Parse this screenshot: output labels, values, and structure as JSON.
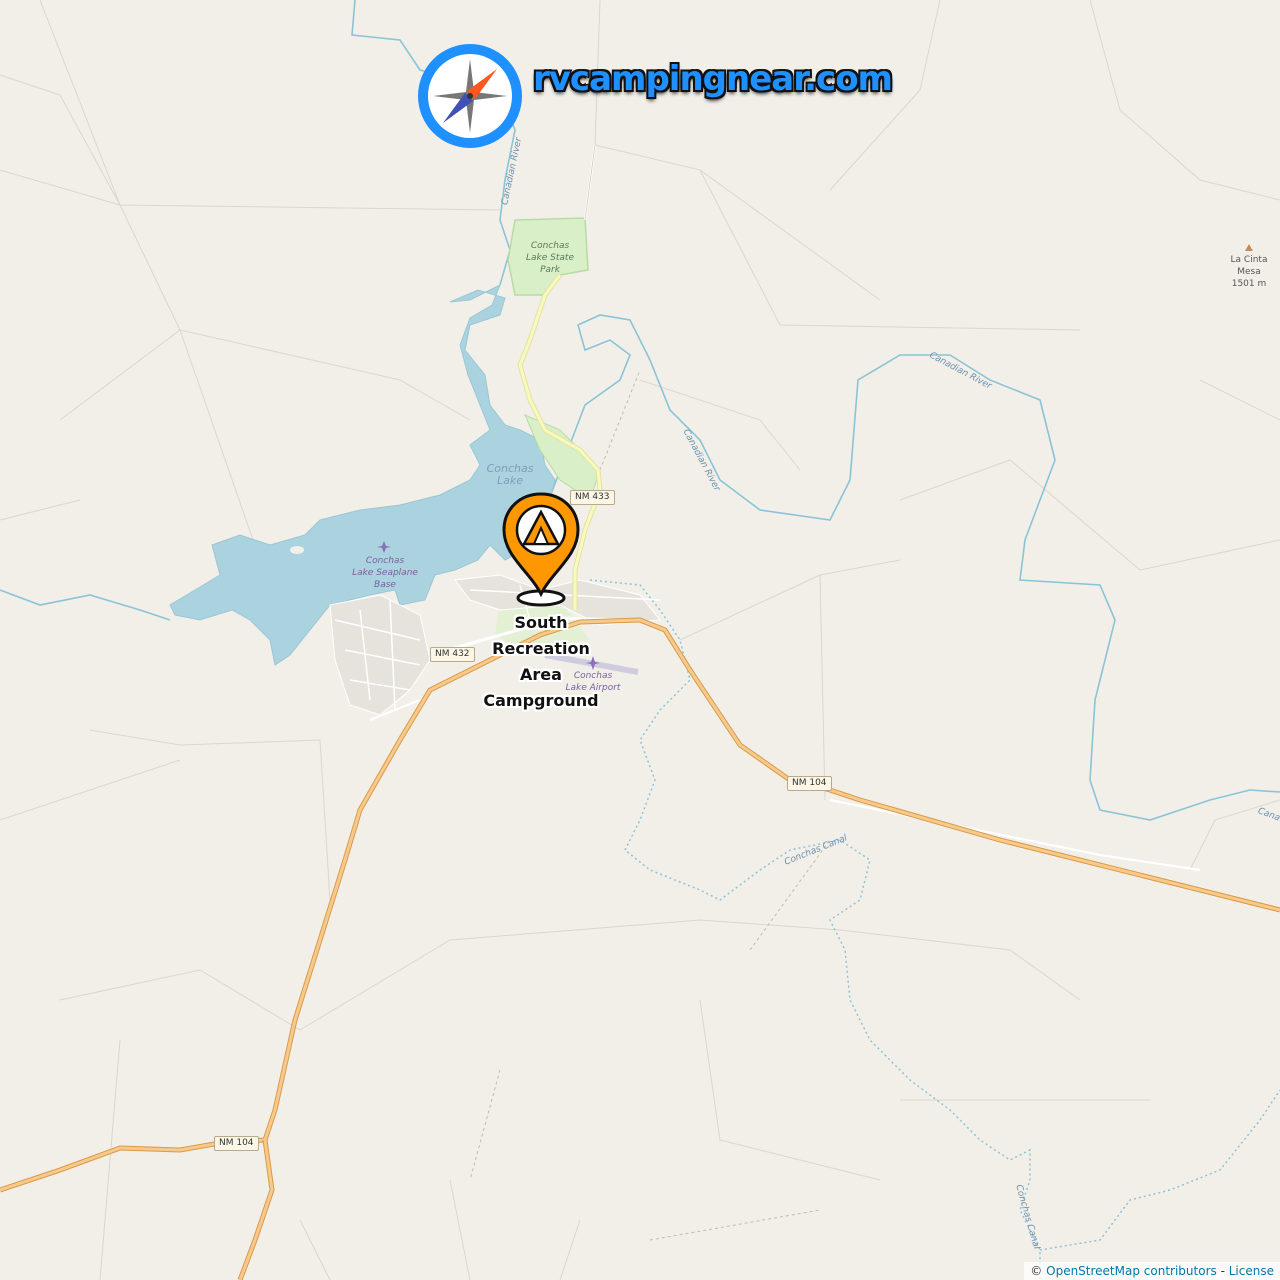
{
  "brand": {
    "name": "rvcampingnear.com",
    "logo_icon": "compass-icon",
    "accent": "#1e90ff"
  },
  "marker": {
    "icon": "tent-pin-icon",
    "color": "#ff9800",
    "label": "South\nRecreation\nArea\nCampground"
  },
  "places": {
    "lake": "Conchas\nLake",
    "state_park": "Conchas\nLake State\nPark",
    "seaplane_base": "Conchas\nLake Seaplane\nBase",
    "airport": "Conchas\nLake Airport",
    "peak": "La Cinta\nMesa\n1501 m"
  },
  "rivers": {
    "canadian_river_north": "Canadian River",
    "canadian_river_east": "Canadian River",
    "canadian_river_mid": "Canadian River",
    "canadian_river_edge": "Cana",
    "conchas_canal_mid": "Conchas Canal",
    "conchas_canal_south": "Conchas Canal"
  },
  "roads": {
    "nm433": "NM 433",
    "nm432": "NM 432",
    "nm104_east": "NM 104",
    "nm104_south": "NM 104"
  },
  "attribution": {
    "copyright": "©",
    "osm": "OpenStreetMap contributors",
    "separator": "-",
    "license": "License"
  },
  "colors": {
    "land": "#f2efe9",
    "water": "#aad3df",
    "river": "#8ac4d6",
    "park": "#d8efc8",
    "major_road": "#f3b66b"
  }
}
